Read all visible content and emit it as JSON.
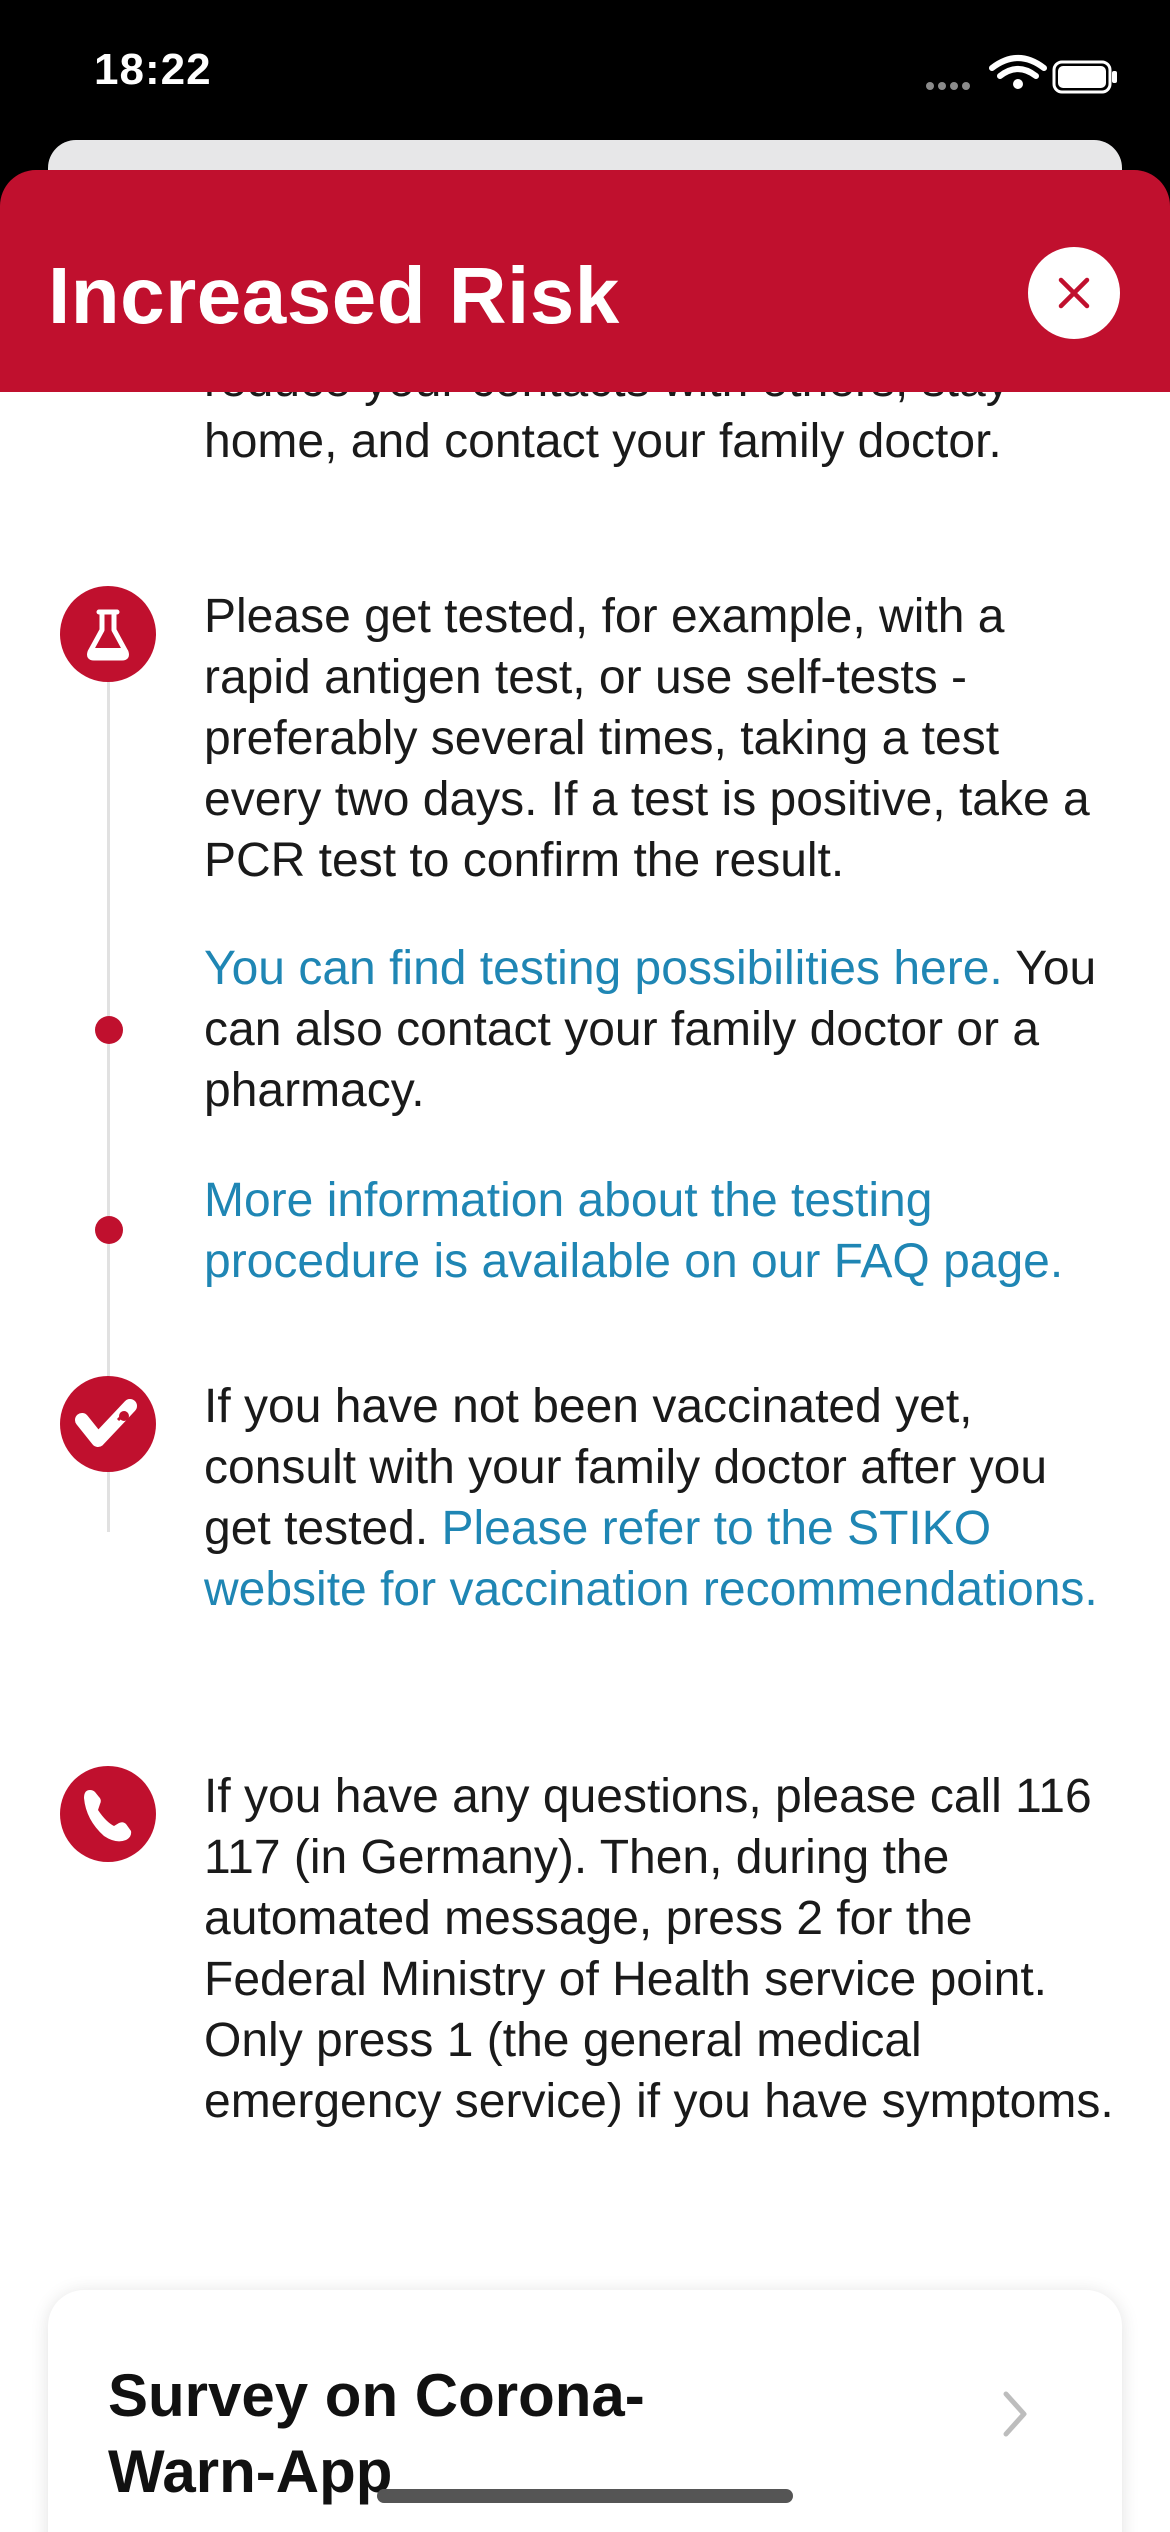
{
  "status_bar": {
    "time": "18:22"
  },
  "header": {
    "title": "Increased Risk",
    "close_icon": "close-icon",
    "color": "#c0102e"
  },
  "sections": {
    "intro_tail": {
      "lines": [
        "reduce your contacts with others, stay",
        "home, and contact your family doctor."
      ]
    },
    "testing": {
      "icon": "test-flask-icon",
      "text": "Please get tested, for example, with a rapid antigen test, or use self-tests - preferably several times, taking a test every two days. If a test is positive, take a PCR test to confirm the result.",
      "link1": "You can find testing possibilities here.",
      "link1_suffix": "You can also contact your family doctor or a pharmacy.",
      "link2": "More information about the testing procedure is available on our FAQ page."
    },
    "vaccination": {
      "icon": "vaccination-icon",
      "text": "If you have not been vaccinated yet, consult with your family doctor after you get tested.",
      "link": "Please refer to the STIKO website for vaccination recommendations."
    },
    "phone": {
      "icon": "phone-icon",
      "text": "If you have any questions, please call 116 117 (in Germany). Then, during the automated message, press 2 for the Federal Ministry of Health service point. Only press 1 (the general medical emergency service) if you have symptoms."
    }
  },
  "survey_card": {
    "title": "Survey on Corona-Warn-App",
    "chevron_icon": "chevron-right-icon"
  },
  "colors": {
    "accent_red": "#c0102e",
    "link_blue": "#1f86b4"
  }
}
